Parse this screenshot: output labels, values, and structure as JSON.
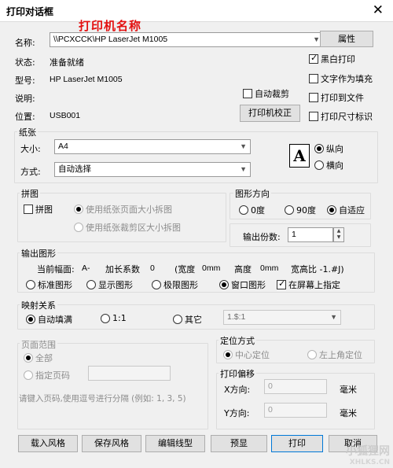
{
  "window": {
    "title": "打印对话框",
    "close_glyph": "✕"
  },
  "overlay_text": "打印机名称",
  "printer": {
    "name_label": "名称:",
    "name_value": "\\\\PCXCCK\\HP LaserJet M1005",
    "properties_btn": "属性",
    "status_label": "状态:",
    "status_value": "准备就绪",
    "model_label": "型号:",
    "model_value": "HP LaserJet M1005",
    "desc_label": "说明:",
    "location_label": "位置:",
    "location_value": "USB001",
    "auto_crop_label": "自动裁剪",
    "calibrate_btn": "打印机校正"
  },
  "options": {
    "bw": {
      "label": "黑白打印",
      "checked": true
    },
    "text_fill": {
      "label": "文字作为填充",
      "checked": false
    },
    "to_file": {
      "label": "打印到文件",
      "checked": false
    },
    "size_mark": {
      "label": "打印尺寸标识",
      "checked": false
    }
  },
  "paper": {
    "title": "纸张",
    "size_label": "大小:",
    "size_value": "A4",
    "source_label": "方式:",
    "source_value": "自动选择",
    "icon_letter": "A",
    "portrait": "纵向",
    "landscape": "横向"
  },
  "tile": {
    "title": "拼图",
    "checkbox": "拼图",
    "opt1": "使用纸张页面大小拆图",
    "opt2": "使用纸张裁剪区大小拆图"
  },
  "orientation": {
    "title": "图形方向",
    "deg0": "0度",
    "deg90": "90度",
    "auto": "自适应",
    "copies_label": "输出份数:",
    "copies_value": "1"
  },
  "output": {
    "title": "输出图形",
    "info": [
      "当前幅面:",
      "A-",
      "加长系数",
      "0",
      "(宽度",
      "0mm",
      "高度",
      "0mm",
      "宽高比 -1.#J)"
    ],
    "std": "标准图形",
    "show": "显示图形",
    "limit": "极限图形",
    "window": "窗口图形",
    "onscreen": "在屏幕上指定"
  },
  "mapping": {
    "title": "映射关系",
    "autofill": "自动填满",
    "one": "1:1",
    "other": "其它",
    "other_value": "1.$:1"
  },
  "range": {
    "title": "页面范围",
    "all": "全部",
    "pages": "指定页码",
    "hint": "请键入页码,使用逗号进行分隔 (例如: 1, 3, 5)"
  },
  "position": {
    "title": "定位方式",
    "center": "中心定位",
    "topleft": "左上角定位"
  },
  "offset": {
    "title": "打印偏移",
    "x_label": "X方向:",
    "x_value": "0",
    "y_label": "Y方向:",
    "y_value": "0",
    "unit": "毫米"
  },
  "buttons": {
    "load_style": "载入风格",
    "save_style": "保存风格",
    "edit_line": "编辑线型",
    "preview": "预显",
    "print": "打印",
    "cancel": "取消"
  },
  "watermark": {
    "main": "小狐狸网",
    "sub": "XHLKS.CN"
  }
}
